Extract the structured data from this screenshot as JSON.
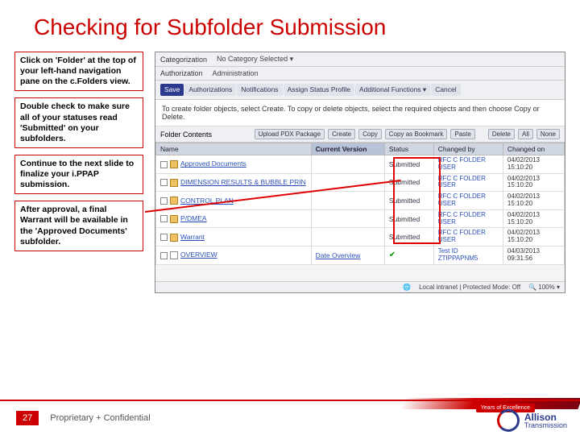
{
  "title": "Checking for Subfolder Submission",
  "instructions": [
    "Click on 'Folder' at the top of your left-hand navigation pane on the c.Folders view.",
    "Double check to make sure all of your statuses read 'Submitted' on your subfolders.",
    "Continue to the next slide to finalize your i.PPAP submission.",
    "After approval, a final Warrant will be available in the 'Approved Documents' subfolder."
  ],
  "app": {
    "cat_lbl": "Categorization",
    "cat_val": "No Category Selected ▾",
    "auth_lbl": "Authorization",
    "auth_val": "Administration",
    "tabs": [
      "Save",
      "Authorizations",
      "Notifications",
      "Assign Status Profile",
      "Additional Functions ▾",
      "Cancel"
    ],
    "help": "To create folder objects, select Create. To copy or delete objects, select the required objects and then choose Copy or Delete.",
    "fc_label": "Folder Contents",
    "fc_btns_left": [
      "Upload PDX Package",
      "Create",
      "Copy",
      "Copy as Bookmark",
      "Paste"
    ],
    "fc_btns_right": [
      "Delete",
      "All",
      "None"
    ],
    "cols": {
      "name": "Name",
      "cv": "Current Version",
      "status": "Status",
      "chg": "Changed by",
      "date": "Changed on"
    },
    "rows": [
      {
        "name": "Approved Documents",
        "status": "Submitted",
        "chg": "RFC C FOLDER USER",
        "date": "04/02/2013 15:10:20"
      },
      {
        "name": "DIMENSION RESULTS & BUBBLE PRIN",
        "status": "Submitted",
        "chg": "RFC C FOLDER USER",
        "date": "04/02/2013 15:10:20"
      },
      {
        "name": "CONTROL PLAN",
        "status": "Submitted",
        "chg": "RFC C FOLDER USER",
        "date": "04/02/2013 15:10:20"
      },
      {
        "name": "P/DMEA",
        "status": "Submitted",
        "chg": "RFC C FOLDER USER",
        "date": "04/02/2013 15:10:20"
      },
      {
        "name": "Warrant",
        "status": "Submitted",
        "chg": "RFC C FOLDER USER",
        "date": "04/02/2013 15:10:20"
      }
    ],
    "overview": {
      "name": "OVERVIEW",
      "link": "Date Overview",
      "chg": "Test ID ZTIPPAPNM5",
      "date": "04/03/2013 09:31:56"
    },
    "status": {
      "mode": "Local intranet | Protected Mode: Off",
      "zoom": "100%"
    }
  },
  "footer": {
    "page": "27",
    "conf": "Proprietary + Confidential",
    "ribbon": "Years of Excellence",
    "brand": "Allison",
    "brand2": "Transmission"
  }
}
